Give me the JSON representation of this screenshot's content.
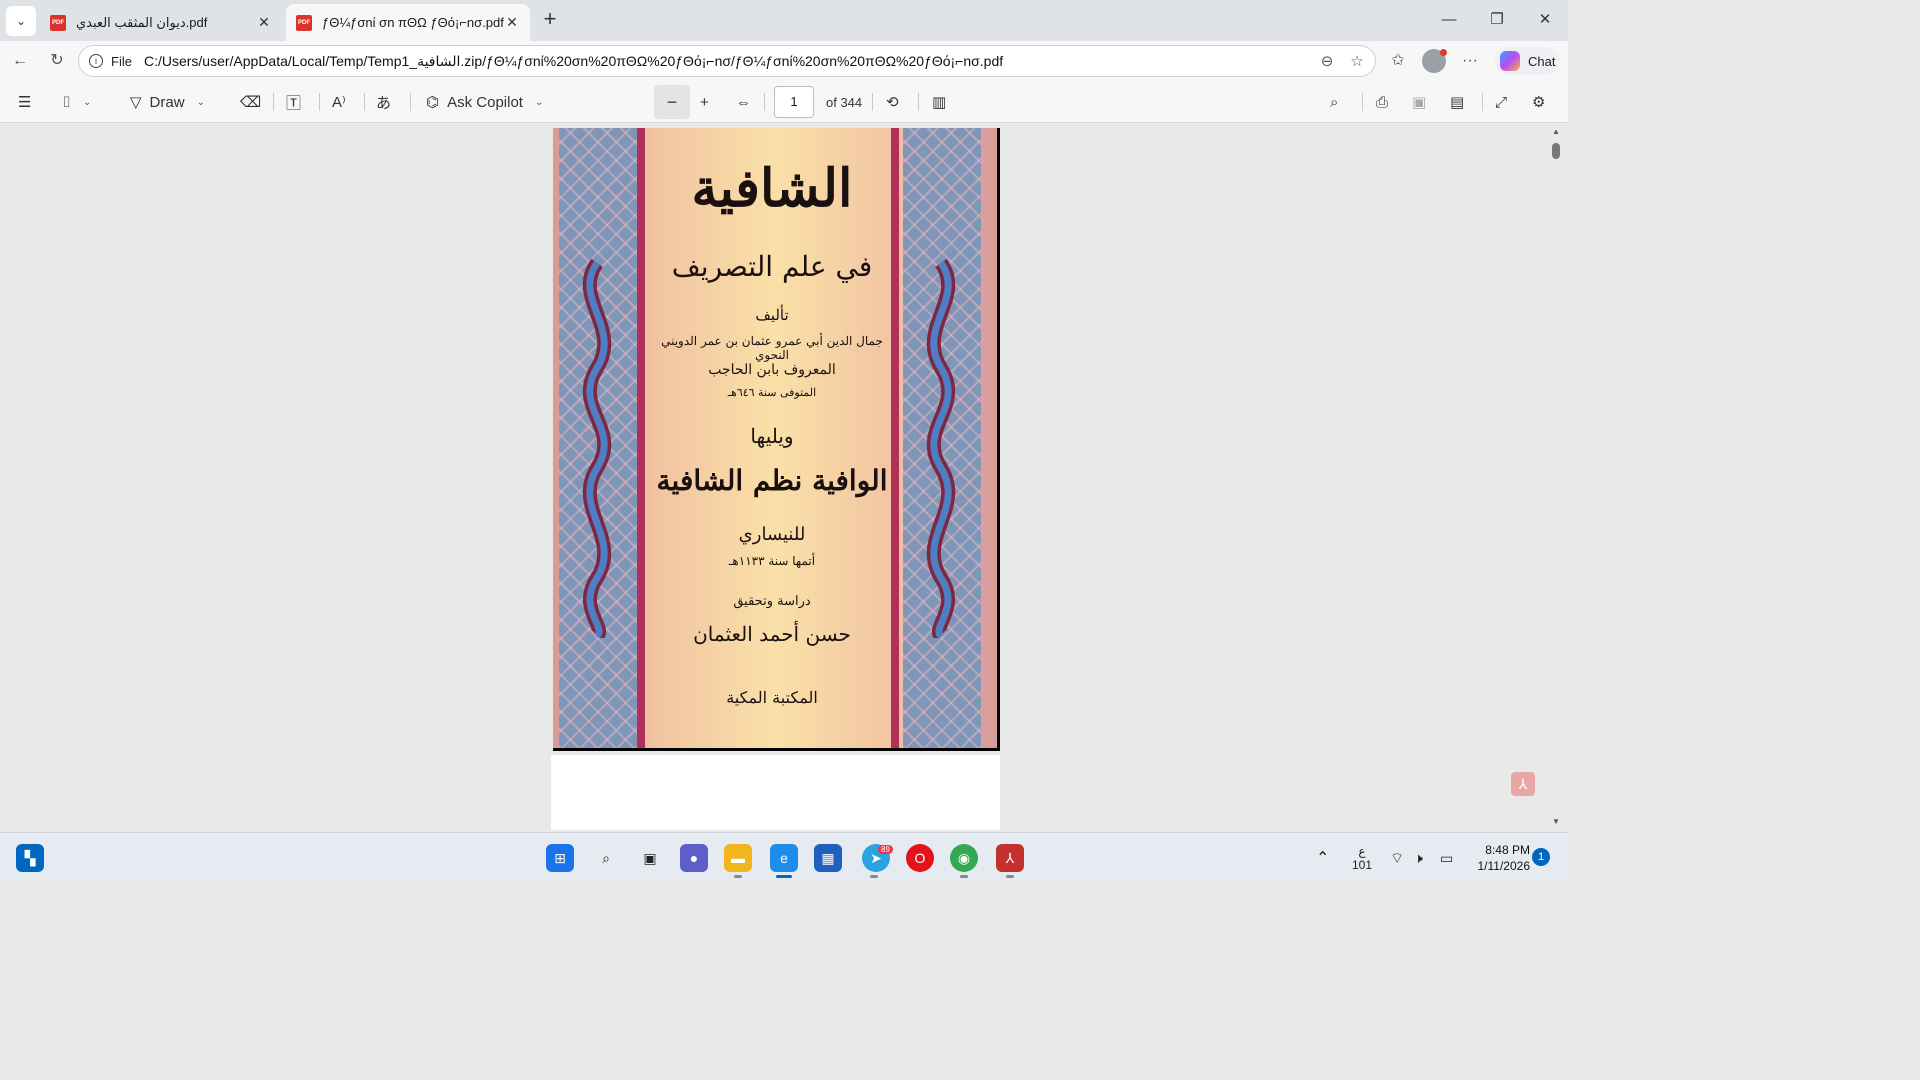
{
  "tabs": [
    {
      "title": "ديوان المثقب العبدي.pdf",
      "active": false
    },
    {
      "title": "ƒΘ¼ƒσnί σn πΘΩ ƒΘό¡⌐nσ.pdf",
      "active": true
    }
  ],
  "address": {
    "scheme_label": "File",
    "url": "C:/Users/user/AppData/Local/Temp/Temp1_الشافية.zip/ƒΘ¼ƒσnί%20σn%20πΘΩ%20ƒΘό¡⌐nσ/ƒΘ¼ƒσnί%20σn%20πΘΩ%20ƒΘό¡⌐nσ.pdf"
  },
  "browser": {
    "chat_label": "Chat"
  },
  "pdf_toolbar": {
    "draw_label": "Draw",
    "ask_copilot_label": "Ask Copilot",
    "page_current": "1",
    "page_total_label": "of 344"
  },
  "cover": {
    "title": "الشافية",
    "subtitle": "في علم التصريف",
    "author_intro": "تأليف",
    "author_name": "جمال الدين أبي عمرو عثمان بن عمر الدويني النحوي",
    "author_known": "المعروف بابن الحاجب",
    "author_death": "المتوفى سنة ٦٤٦هـ",
    "followed_by": "ويليها",
    "second_title": "الوافية نظم الشافية",
    "second_author": "للنيساري",
    "completed": "أتمها سنة ١١٣٣هـ",
    "study_label": "دراسة وتحقيق",
    "editor": "حسن أحمد العثمان",
    "publisher": "المكتبة المكية"
  },
  "taskbar": {
    "telegram_badge": "89",
    "lang_indicator": "ع",
    "lang_sub": "101",
    "time": "8:48 PM",
    "date": "1/11/2026",
    "notification_count": "1"
  },
  "colors": {
    "accent": "#0067c0",
    "pdf_red": "#d9342b",
    "cover_panel_blue": "#7e96b8",
    "cover_stripe": "#b0305a"
  }
}
